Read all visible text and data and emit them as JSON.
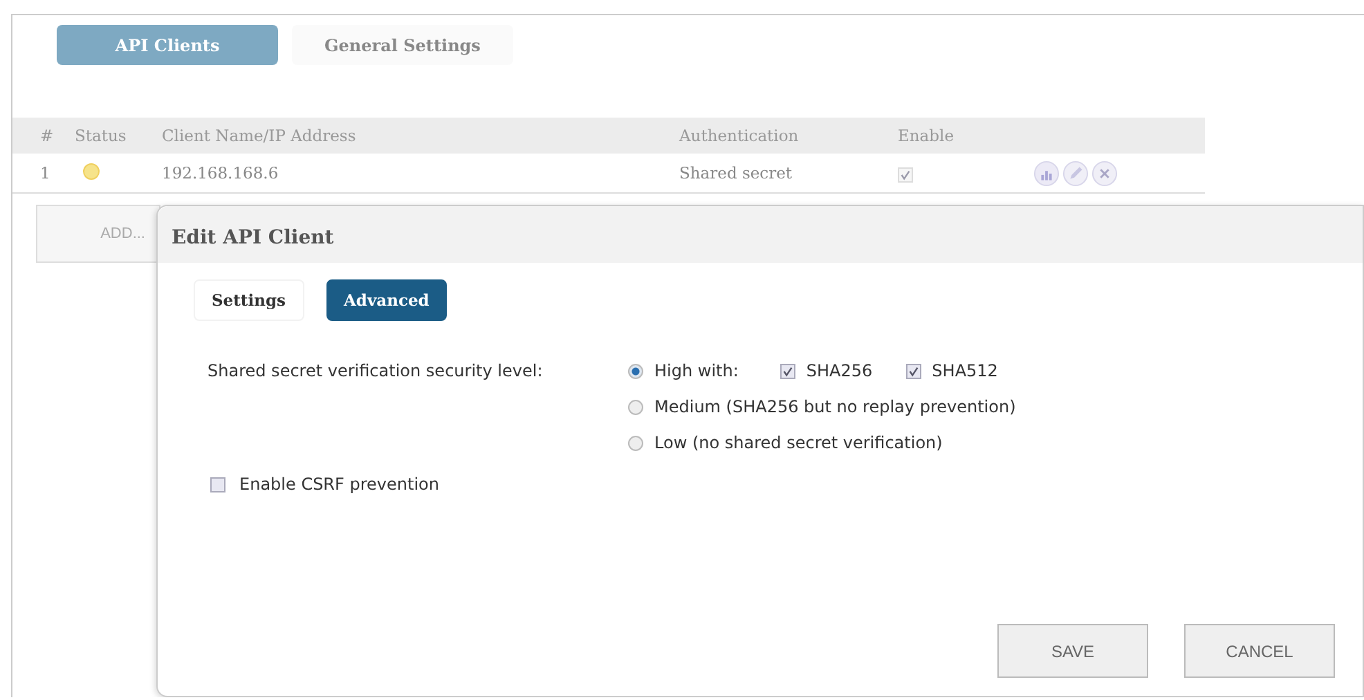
{
  "tabs": [
    {
      "label": "API Clients",
      "selected": true
    },
    {
      "label": "General Settings",
      "selected": false
    }
  ],
  "table": {
    "columns": [
      "#",
      "Status",
      "Client Name/IP Address",
      "Authentication",
      "Enable"
    ],
    "rows": [
      {
        "number": "1",
        "client": "192.168.168.6",
        "authentication": "Shared secret",
        "enabled": true
      }
    ]
  },
  "add_button": "ADD...",
  "dialog": {
    "title": "Edit API Client",
    "tabs": [
      {
        "label": "Settings",
        "selected": false
      },
      {
        "label": "Advanced",
        "selected": true
      }
    ],
    "security_label": "Shared secret verification security level:",
    "levels": [
      {
        "label": "High with:",
        "selected": true,
        "options": [
          {
            "label": "SHA256",
            "checked": true
          },
          {
            "label": "SHA512",
            "checked": true
          }
        ]
      },
      {
        "label": "Medium (SHA256 but no replay prevention)",
        "selected": false
      },
      {
        "label": "Low (no shared secret verification)",
        "selected": false
      }
    ],
    "csrf": {
      "label": "Enable CSRF prevention",
      "checked": false
    },
    "buttons": [
      "SAVE",
      "CANCEL"
    ]
  }
}
